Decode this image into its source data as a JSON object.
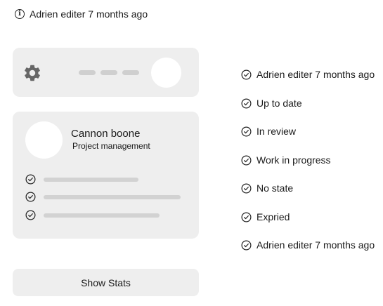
{
  "header": {
    "info_text": "Adrien editer 7 months ago",
    "icon": "info-icon"
  },
  "settings_card": {
    "icon": "gear-icon"
  },
  "profile_card": {
    "name": "Cannon boone",
    "role": "Project management",
    "tasks": [
      {
        "icon": "check-circle-icon"
      },
      {
        "icon": "check-circle-icon"
      },
      {
        "icon": "check-circle-icon"
      }
    ]
  },
  "actions": {
    "show_stats_label": "Show Stats"
  },
  "status_list": [
    {
      "label": "Adrien editer 7 months ago",
      "icon": "check-circle-icon"
    },
    {
      "label": "Up to date",
      "icon": "check-circle-icon"
    },
    {
      "label": "In review",
      "icon": "check-circle-icon"
    },
    {
      "label": "Work in progress",
      "icon": "check-circle-icon"
    },
    {
      "label": "No state",
      "icon": "check-circle-icon"
    },
    {
      "label": "Expried",
      "icon": "check-circle-icon"
    },
    {
      "label": "Adrien editer 7 months ago",
      "icon": "check-circle-icon"
    }
  ],
  "colors": {
    "card_bg": "#eeeeee",
    "placeholder": "#d2d2d2",
    "gear": "#666666",
    "text": "#1a1a1a"
  }
}
